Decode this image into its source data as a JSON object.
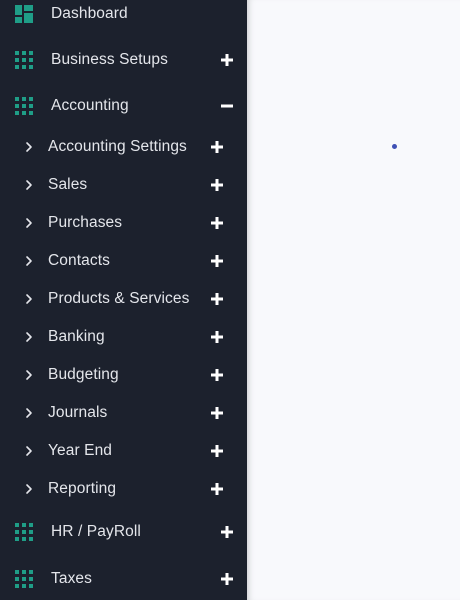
{
  "colors": {
    "sidebar_bg": "#1c212d",
    "text": "#e4e6eb",
    "accent": "#1f9e87",
    "content_bg": "#f8f9fc",
    "dot": "#3f51b5"
  },
  "sidebar": {
    "top_items": [
      {
        "label": "Dashboard",
        "icon": "dashboard-icon",
        "action": ""
      },
      {
        "label": "Business Setups",
        "icon": "grid-icon",
        "action": "expand"
      },
      {
        "label": "Accounting",
        "icon": "grid-icon",
        "action": "collapse"
      }
    ],
    "accounting_submenu": [
      {
        "label": "Accounting Settings"
      },
      {
        "label": "Sales"
      },
      {
        "label": "Purchases"
      },
      {
        "label": "Contacts"
      },
      {
        "label": "Products & Services"
      },
      {
        "label": "Banking"
      },
      {
        "label": "Budgeting"
      },
      {
        "label": "Journals"
      },
      {
        "label": "Year End"
      },
      {
        "label": "Reporting"
      }
    ],
    "bottom_items": [
      {
        "label": "HR / PayRoll",
        "icon": "grid-icon",
        "action": "expand"
      },
      {
        "label": "Taxes",
        "icon": "grid-icon",
        "action": "expand"
      }
    ]
  }
}
